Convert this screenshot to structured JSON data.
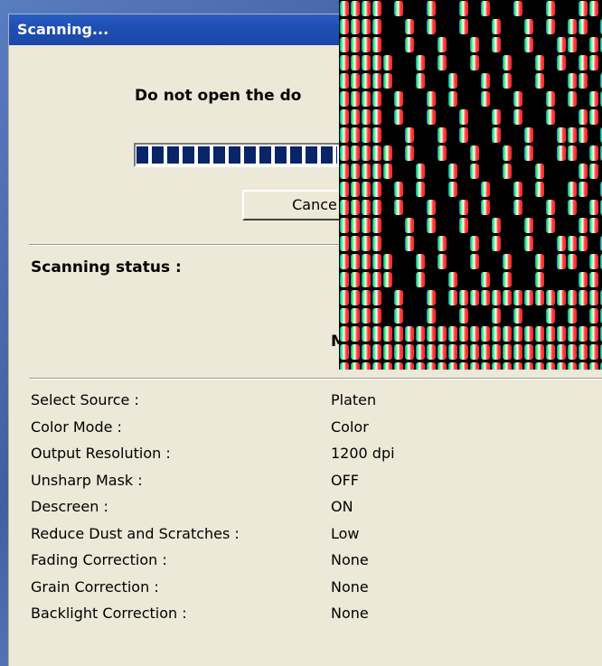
{
  "window": {
    "title": "Scanning..."
  },
  "progress_dialog": {
    "warning_text": "Do not open the do",
    "progress_fraction": 0.95,
    "cancel_label": "Cance"
  },
  "status": {
    "label": "Scanning status :",
    "value": "M"
  },
  "settings": [
    {
      "name": "Select Source :",
      "value": "Platen"
    },
    {
      "name": "Color Mode :",
      "value": "Color"
    },
    {
      "name": "Output Resolution :",
      "value": "1200 dpi"
    },
    {
      "name": "Unsharp Mask :",
      "value": "OFF"
    },
    {
      "name": "Descreen :",
      "value": "ON"
    },
    {
      "name": "Reduce Dust and Scratches :",
      "value": "Low"
    },
    {
      "name": "Fading Correction :",
      "value": "None"
    },
    {
      "name": "Grain Correction :",
      "value": "None"
    },
    {
      "name": "Backlight Correction :",
      "value": "None"
    }
  ],
  "colors": {
    "titlebar": "#1f4fb4",
    "window_face": "#ece9d8",
    "progress_block": "#0a246a",
    "text": "#000000"
  },
  "icons": {
    "overlay": "magnified-screen-pixels-image"
  }
}
